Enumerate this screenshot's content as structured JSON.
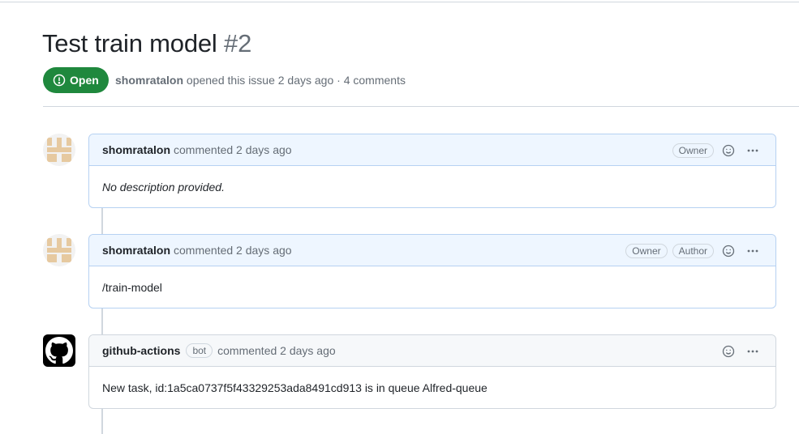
{
  "issue": {
    "title": "Test train model",
    "number": "#2",
    "state": "Open",
    "opened_by": "shomratalon",
    "opened_text": "opened this issue 2 days ago",
    "separator": "·",
    "comments_count": "4 comments"
  },
  "comments": [
    {
      "author": "shomratalon",
      "action": "commented 2 days ago",
      "labels": [
        "Owner"
      ],
      "body": "No description provided.",
      "avatar_icon": "identicon-avatar"
    },
    {
      "author": "shomratalon",
      "action": "commented 2 days ago",
      "labels": [
        "Owner",
        "Author"
      ],
      "body": "/train-model",
      "avatar_icon": "identicon-avatar"
    },
    {
      "author": "github-actions",
      "bot_label": "bot",
      "action": "commented 2 days ago",
      "body": "New task, id:1a5ca0737f5f43329253ada8491cd913 is in queue Alfred-queue",
      "avatar_icon": "github-octocat-icon"
    }
  ],
  "colors": {
    "open_green": "#1f883d",
    "owner_header_bg": "#eef6ff",
    "owner_border": "#b6d1f2",
    "identicon": "#e6c9a0"
  }
}
